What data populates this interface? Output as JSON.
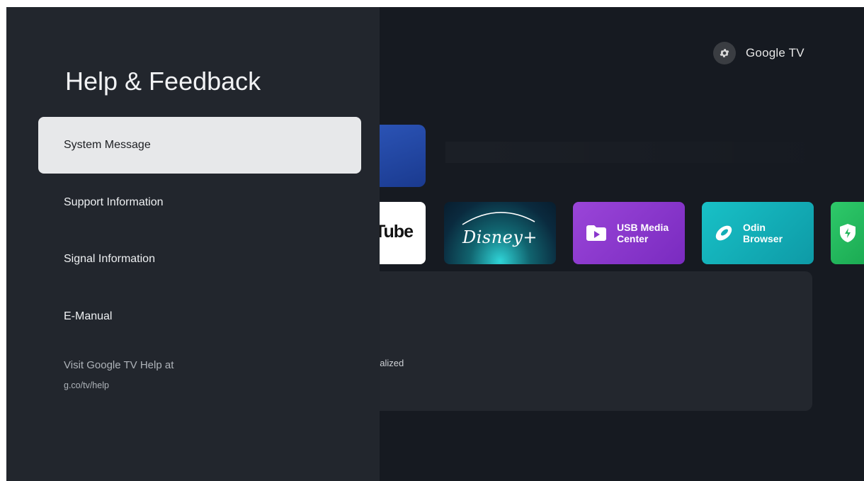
{
  "panel": {
    "title": "Help & Feedback",
    "items": [
      {
        "label": "System Message",
        "selected": true
      },
      {
        "label": "Support Information"
      },
      {
        "label": "Signal Information"
      },
      {
        "label": "E-Manual"
      }
    ],
    "help_text": "Visit Google TV Help at",
    "help_url": "g.co/tv/help"
  },
  "home": {
    "brand": "Google TV",
    "settings_icon": "gear-icon",
    "apps": [
      {
        "label": "Tube",
        "icon": "youtube-logo"
      },
      {
        "label": "Disney+",
        "icon": "disney-plus-logo"
      },
      {
        "label": "USB Media\nCenter",
        "icon": "play-folder-icon"
      },
      {
        "label": "Odin\nBrowser",
        "icon": "odin-browser-icon"
      },
      {
        "label": "",
        "icon": "shield-bolt-icon"
      }
    ],
    "card_text": "nalized"
  },
  "colors": {
    "panel_bg": "#22262d",
    "selected_bg": "#e7e8ea",
    "screen_bg": "#161a21",
    "usb_tile": "#9a45d8",
    "odin_tile": "#18c1c7",
    "green_tile": "#2ec96a"
  }
}
